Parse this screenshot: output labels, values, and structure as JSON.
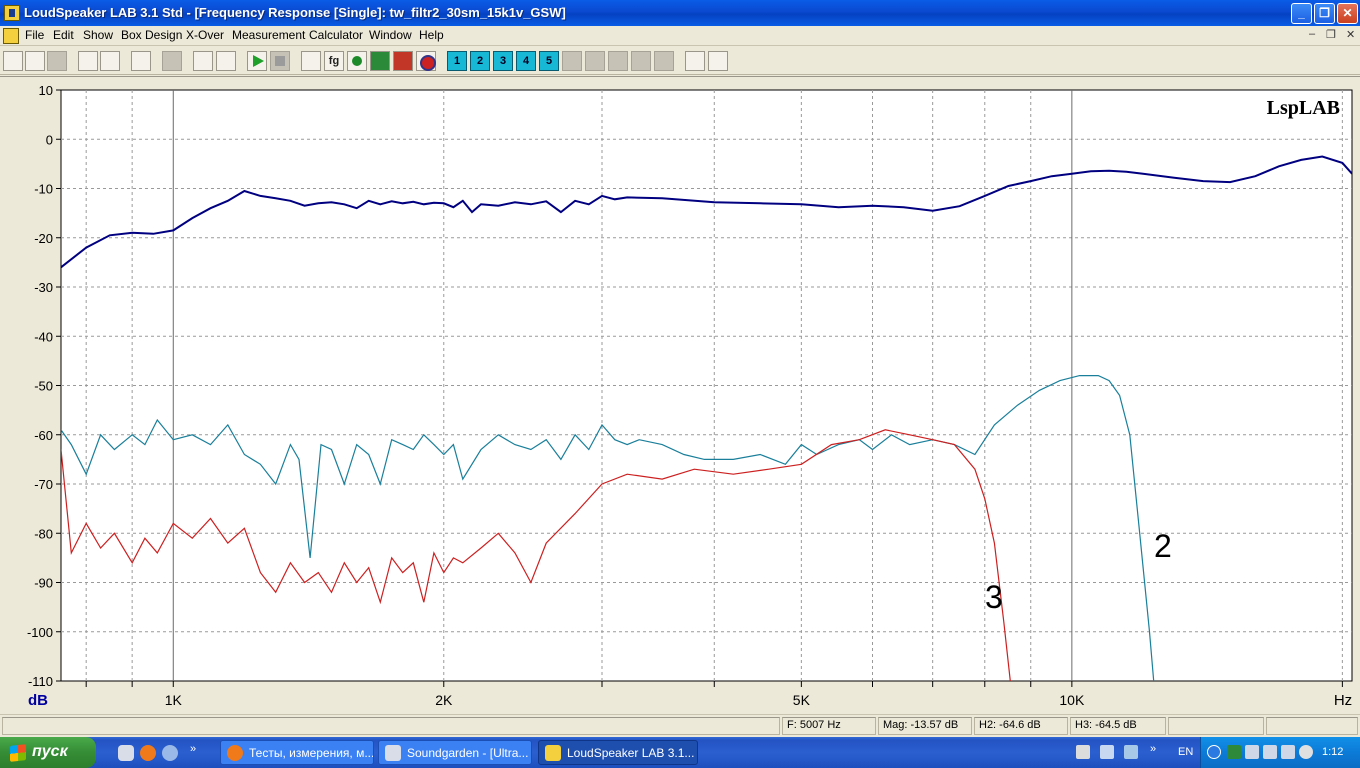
{
  "window": {
    "title": "LoudSpeaker LAB 3.1 Std - [Frequency Response [Single]: tw_filtr2_30sm_15k1v_GSW]",
    "buttons": {
      "minimize": "_",
      "maximize": "❐",
      "close": "✕"
    }
  },
  "menu": {
    "items": [
      "File",
      "Edit",
      "Show",
      "Box Design",
      "X-Over",
      "Measurement",
      "Calculator",
      "Window",
      "Help"
    ],
    "mdi": {
      "minimize": "–",
      "restore": "❐",
      "close": "✕"
    }
  },
  "toolbar": {
    "number_buttons": [
      "1",
      "2",
      "3",
      "4",
      "5"
    ],
    "fg_label": "fg"
  },
  "colors": {
    "plot_bg": "#ffffff",
    "grid": "#9a9a9a",
    "curve_main": "#000080",
    "curve_h2": "#1a7f9a",
    "curve_h3": "#cc2020"
  },
  "chart_data": {
    "type": "line",
    "watermark": "LspLAB",
    "y_unit_label": "dB",
    "x_unit_label": "Hz",
    "x_scale": "log",
    "xlim": [
      750,
      20500
    ],
    "ylim": [
      -110,
      10
    ],
    "grid": true,
    "y_ticks": [
      10,
      0,
      -10,
      -20,
      -30,
      -40,
      -50,
      -60,
      -70,
      -80,
      -90,
      -100,
      -110
    ],
    "x_tick_labels": [
      {
        "value": 1000,
        "label": "1K"
      },
      {
        "value": 2000,
        "label": "2K"
      },
      {
        "value": 5000,
        "label": "5K"
      },
      {
        "value": 10000,
        "label": "10K"
      }
    ],
    "x_minor_grid": [
      800,
      900,
      1000,
      2000,
      3000,
      4000,
      5000,
      6000,
      7000,
      8000,
      9000,
      10000,
      20000
    ],
    "series": [
      {
        "color": "#000080",
        "x": [
          750,
          800,
          850,
          900,
          950,
          1000,
          1050,
          1100,
          1150,
          1200,
          1250,
          1300,
          1350,
          1400,
          1450,
          1500,
          1550,
          1600,
          1650,
          1700,
          1750,
          1800,
          1850,
          1900,
          1950,
          2000,
          2050,
          2100,
          2150,
          2200,
          2300,
          2400,
          2500,
          2600,
          2700,
          2800,
          2900,
          3000,
          3100,
          3200,
          3500,
          4000,
          4500,
          5000,
          5500,
          6000,
          6500,
          7000,
          7500,
          8000,
          8500,
          9000,
          9500,
          10000,
          10500,
          11000,
          11500,
          12000,
          13000,
          14000,
          15000,
          16000,
          17000,
          18000,
          19000,
          20000,
          20500
        ],
        "y": [
          -26,
          -22,
          -19.5,
          -19,
          -19.2,
          -18.5,
          -16,
          -14,
          -12.5,
          -10.5,
          -11.5,
          -12,
          -12.5,
          -13.5,
          -13,
          -12.8,
          -13.2,
          -14,
          -12.5,
          -13.2,
          -12.6,
          -13,
          -12.7,
          -13.2,
          -12.9,
          -13,
          -13.8,
          -12.5,
          -14.8,
          -13.2,
          -13.5,
          -12.8,
          -13.2,
          -12.6,
          -14.8,
          -12.5,
          -13.2,
          -11.5,
          -12.2,
          -11.8,
          -12,
          -12.8,
          -13,
          -13.2,
          -13.8,
          -13.5,
          -13.8,
          -14.5,
          -13.6,
          -11.5,
          -9.5,
          -8.5,
          -7.5,
          -7,
          -6.5,
          -6.4,
          -6.6,
          -7,
          -7.8,
          -8.5,
          -8.7,
          -7.5,
          -5.5,
          -4.2,
          -3.5,
          -4.8,
          -7
        ]
      },
      {
        "color": "#1a7f9a",
        "label": "2",
        "x": [
          750,
          770,
          800,
          830,
          860,
          900,
          930,
          960,
          1000,
          1050,
          1100,
          1150,
          1200,
          1250,
          1300,
          1350,
          1380,
          1420,
          1460,
          1500,
          1550,
          1600,
          1650,
          1700,
          1750,
          1800,
          1850,
          1900,
          1950,
          2000,
          2050,
          2100,
          2200,
          2300,
          2400,
          2500,
          2600,
          2700,
          2800,
          2900,
          3000,
          3100,
          3200,
          3300,
          3500,
          3700,
          3900,
          4200,
          4500,
          4800,
          5000,
          5200,
          5500,
          5800,
          6000,
          6300,
          6600,
          7000,
          7400,
          7800,
          8200,
          8700,
          9200,
          9700,
          10200,
          10700,
          11000,
          11300,
          11600,
          11900,
          12200,
          12400
        ],
        "y": [
          -59,
          -62,
          -68,
          -60,
          -63,
          -60,
          -62,
          -57,
          -61,
          -60,
          -62,
          -58,
          -64,
          -66,
          -70,
          -62,
          -65,
          -85,
          -62,
          -63,
          -70,
          -62,
          -64,
          -70,
          -61,
          -62,
          -63,
          -60,
          -62,
          -64,
          -62,
          -69,
          -63,
          -60,
          -62,
          -63,
          -61,
          -65,
          -60,
          -63,
          -58,
          -61,
          -62,
          -61,
          -62,
          -64,
          -65,
          -65,
          -64,
          -66,
          -62,
          -64,
          -62,
          -61,
          -63,
          -60,
          -62,
          -61,
          -62,
          -64,
          -58,
          -54,
          -51,
          -49,
          -48,
          -48,
          -49,
          -52,
          -60,
          -80,
          -100,
          -115
        ]
      },
      {
        "color": "#cc2020",
        "label": "3",
        "x": [
          750,
          770,
          800,
          830,
          860,
          900,
          930,
          960,
          1000,
          1050,
          1100,
          1150,
          1200,
          1250,
          1300,
          1350,
          1400,
          1450,
          1500,
          1550,
          1600,
          1650,
          1700,
          1750,
          1800,
          1850,
          1900,
          1950,
          2000,
          2050,
          2100,
          2200,
          2300,
          2400,
          2500,
          2600,
          2800,
          3000,
          3200,
          3500,
          3800,
          4200,
          4600,
          5000,
          5400,
          5800,
          6200,
          6600,
          7000,
          7400,
          7800,
          8000,
          8200,
          8400,
          8600
        ],
        "y": [
          -63,
          -84,
          -78,
          -83,
          -80,
          -86,
          -81,
          -84,
          -78,
          -81,
          -77,
          -82,
          -79,
          -88,
          -92,
          -86,
          -90,
          -88,
          -92,
          -86,
          -90,
          -87,
          -94,
          -85,
          -88,
          -86,
          -94,
          -84,
          -88,
          -85,
          -86,
          -83,
          -80,
          -84,
          -90,
          -82,
          -76,
          -70,
          -68,
          -69,
          -67,
          -68,
          -67,
          -66,
          -62,
          -61,
          -59,
          -60,
          -61,
          -62,
          -67,
          -73,
          -82,
          -98,
          -115
        ]
      }
    ]
  },
  "status": {
    "cell1": "",
    "freq": "F: 5007 Hz",
    "mag": "Mag: -13.57 dB",
    "h2": "H2: -64.6 dB",
    "h3": "H3: -64.5 dB",
    "cell6": "",
    "cell7": ""
  },
  "taskbar": {
    "start_label": "пуск",
    "tasks": [
      {
        "label": "Тесты, измерения, м..."
      },
      {
        "label": "Soundgarden - [Ultra..."
      },
      {
        "label": "LoudSpeaker LAB 3.1..."
      }
    ],
    "lang": "EN",
    "clock": "1:12"
  }
}
